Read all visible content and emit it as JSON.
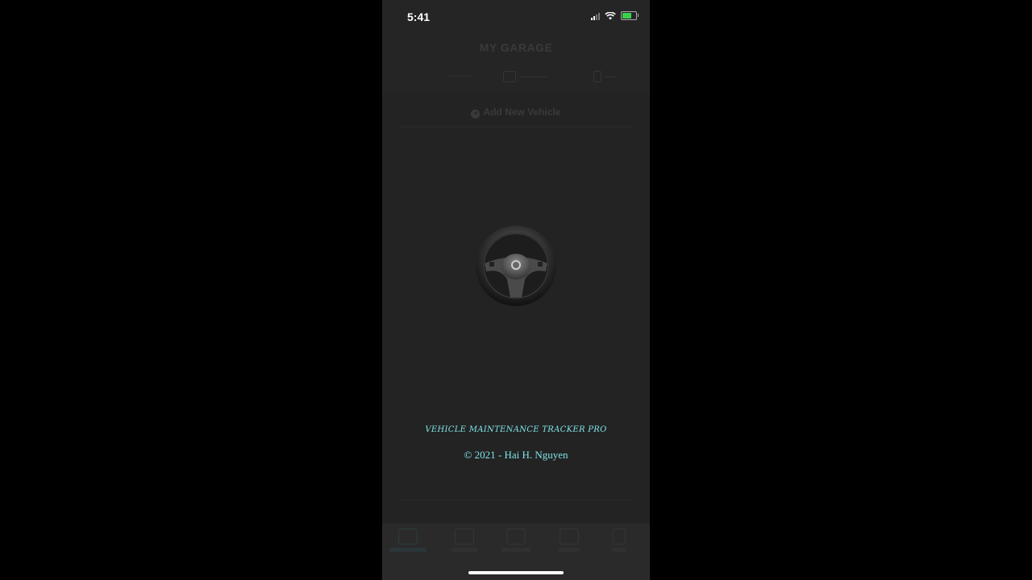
{
  "status_bar": {
    "time": "5:41",
    "icons": [
      "cellular-signal-icon",
      "wifi-icon",
      "battery-charging-icon"
    ],
    "battery_color": "#39d14b"
  },
  "header": {
    "title": "MY GARAGE"
  },
  "garage": {
    "add_vehicle_label": "Add New Vehicle"
  },
  "splash": {
    "logo": "steering-wheel-icon",
    "app_name": "VEHICLE MAINTENANCE TRACKER PRO",
    "copyright": "© 2021 - Hai H. Nguyen",
    "text_color": "#7fe3e8"
  },
  "colors": {
    "screen_bg": "#252525",
    "outer_bg": "#000000"
  }
}
